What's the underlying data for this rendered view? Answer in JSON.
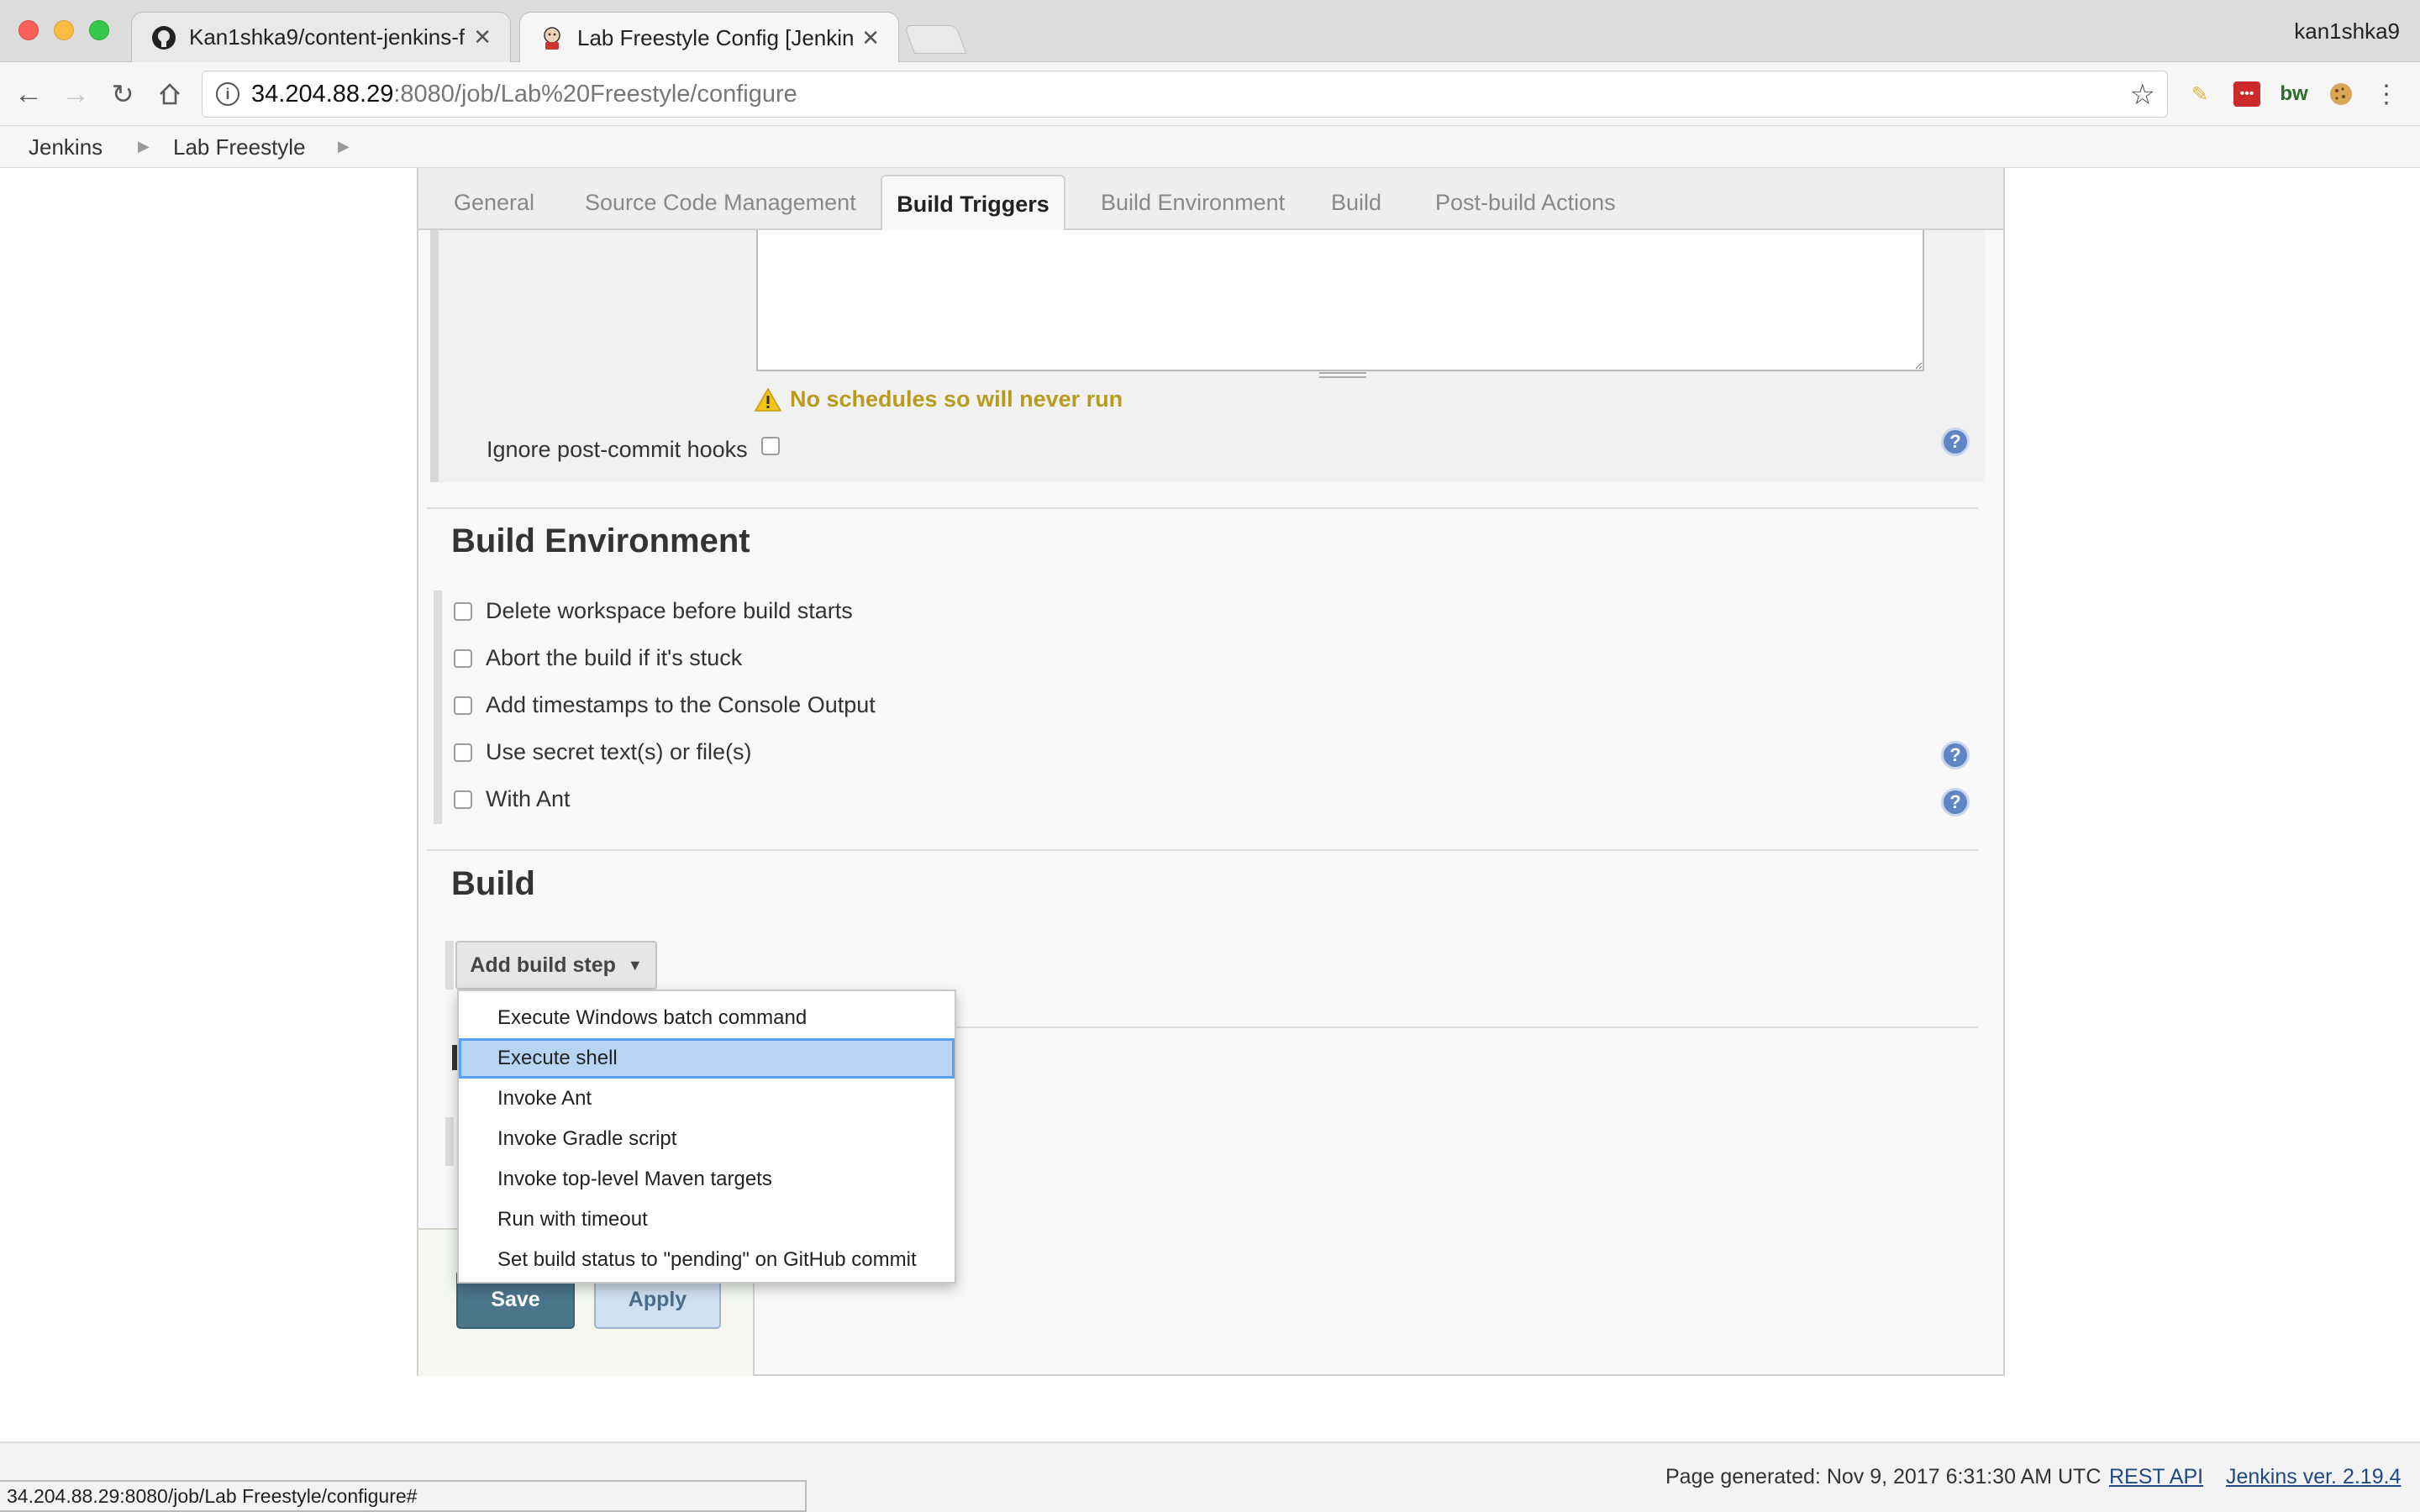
{
  "browser": {
    "tabs": [
      {
        "title": "Kan1shka9/content-jenkins-fr",
        "favicon": "github-icon",
        "active": false
      },
      {
        "title": "Lab Freestyle Config [Jenkins]",
        "favicon": "jenkins-icon",
        "active": true
      }
    ],
    "user": "kan1shka9",
    "url_host": "34.204.88.29",
    "url_path": ":8080/job/Lab%20Freestyle/configure"
  },
  "breadcrumbs": [
    "Jenkins",
    "Lab Freestyle"
  ],
  "config_tabs": [
    "General",
    "Source Code Management",
    "Build Triggers",
    "Build Environment",
    "Build",
    "Post-build Actions"
  ],
  "active_tab": "Build Triggers",
  "triggers": {
    "warning": "No schedules so will never run",
    "ignore_hooks_label": "Ignore post-commit hooks"
  },
  "build_env": {
    "title": "Build Environment",
    "options": [
      "Delete workspace before build starts",
      "Abort the build if it's stuck",
      "Add timestamps to the Console Output",
      "Use secret text(s) or file(s)",
      "With Ant"
    ]
  },
  "build": {
    "title": "Build",
    "add_step_label": "Add build step",
    "menu_items": [
      "Execute Windows batch command",
      "Execute shell",
      "Invoke Ant",
      "Invoke Gradle script",
      "Invoke top-level Maven targets",
      "Run with timeout",
      "Set build status to \"pending\" on GitHub commit"
    ],
    "highlighted_item": "Execute shell"
  },
  "buttons": {
    "save": "Save",
    "apply": "Apply"
  },
  "footer": {
    "generated": "Page generated: Nov 9, 2017 6:31:30 AM UTC",
    "rest_api": "REST API",
    "version": "Jenkins ver. 2.19.4"
  },
  "status_url": "34.204.88.29:8080/job/Lab Freestyle/configure#",
  "colors": {
    "warning": "#b89b1d",
    "save": "#4b758b",
    "apply": "#cfe0f0",
    "highlight": "#b7d4f5",
    "link": "#204a87"
  }
}
